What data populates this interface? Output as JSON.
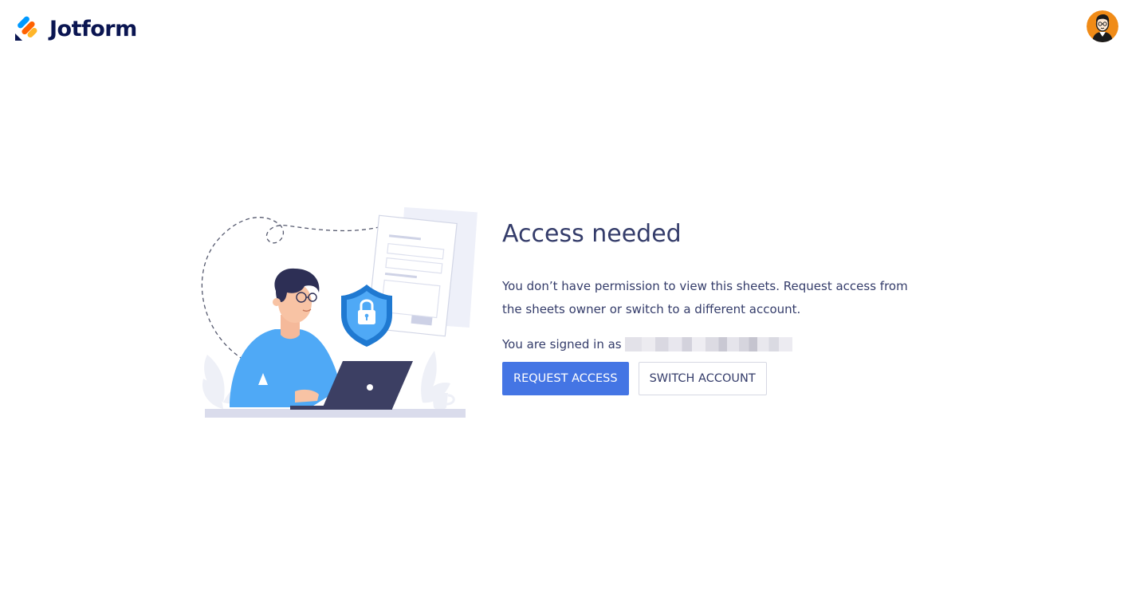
{
  "header": {
    "brand_name": "Jotform",
    "logo_colors": [
      "#0099ff",
      "#ff6100",
      "#ffb629",
      "#0a1551"
    ],
    "avatar_icon": "user-avatar-icon"
  },
  "main": {
    "illustration_icon": "person-laptop-shield-lock-illustration",
    "title": "Access needed",
    "message": "You don’t have permission to view this sheets. Request access from the sheets owner or switch to a different account.",
    "signed_in_label": "You are signed in as",
    "request_access_label": "REQUEST ACCESS",
    "switch_account_label": "SWITCH ACCOUNT"
  },
  "colors": {
    "accent": "#4475e4",
    "text": "#343c6a",
    "brand_navy": "#0a1551"
  }
}
